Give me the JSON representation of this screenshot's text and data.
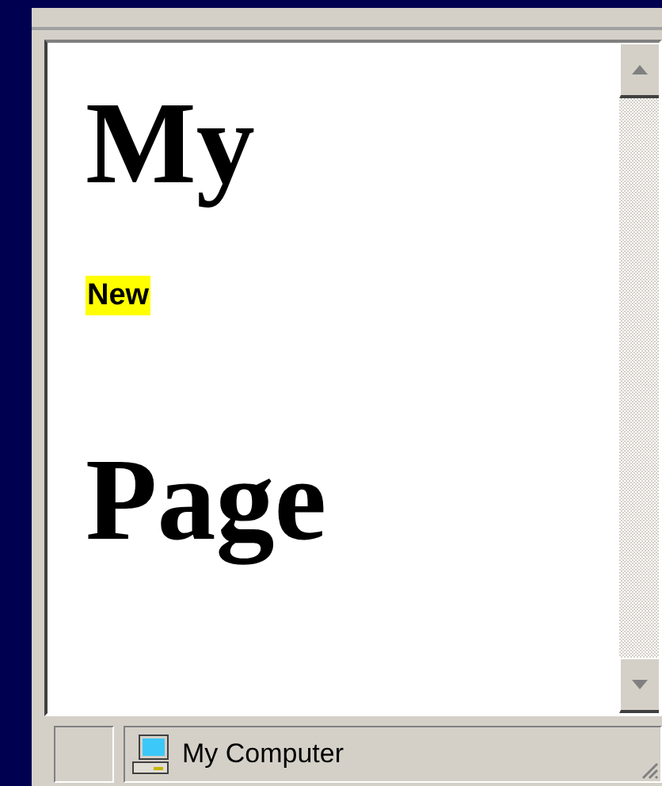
{
  "document": {
    "blocks": [
      {
        "kind": "heading",
        "text": "My"
      },
      {
        "kind": "highlight",
        "text": "New"
      },
      {
        "kind": "heading",
        "text": "Page"
      }
    ]
  },
  "status_bar": {
    "zone": "My Computer"
  }
}
